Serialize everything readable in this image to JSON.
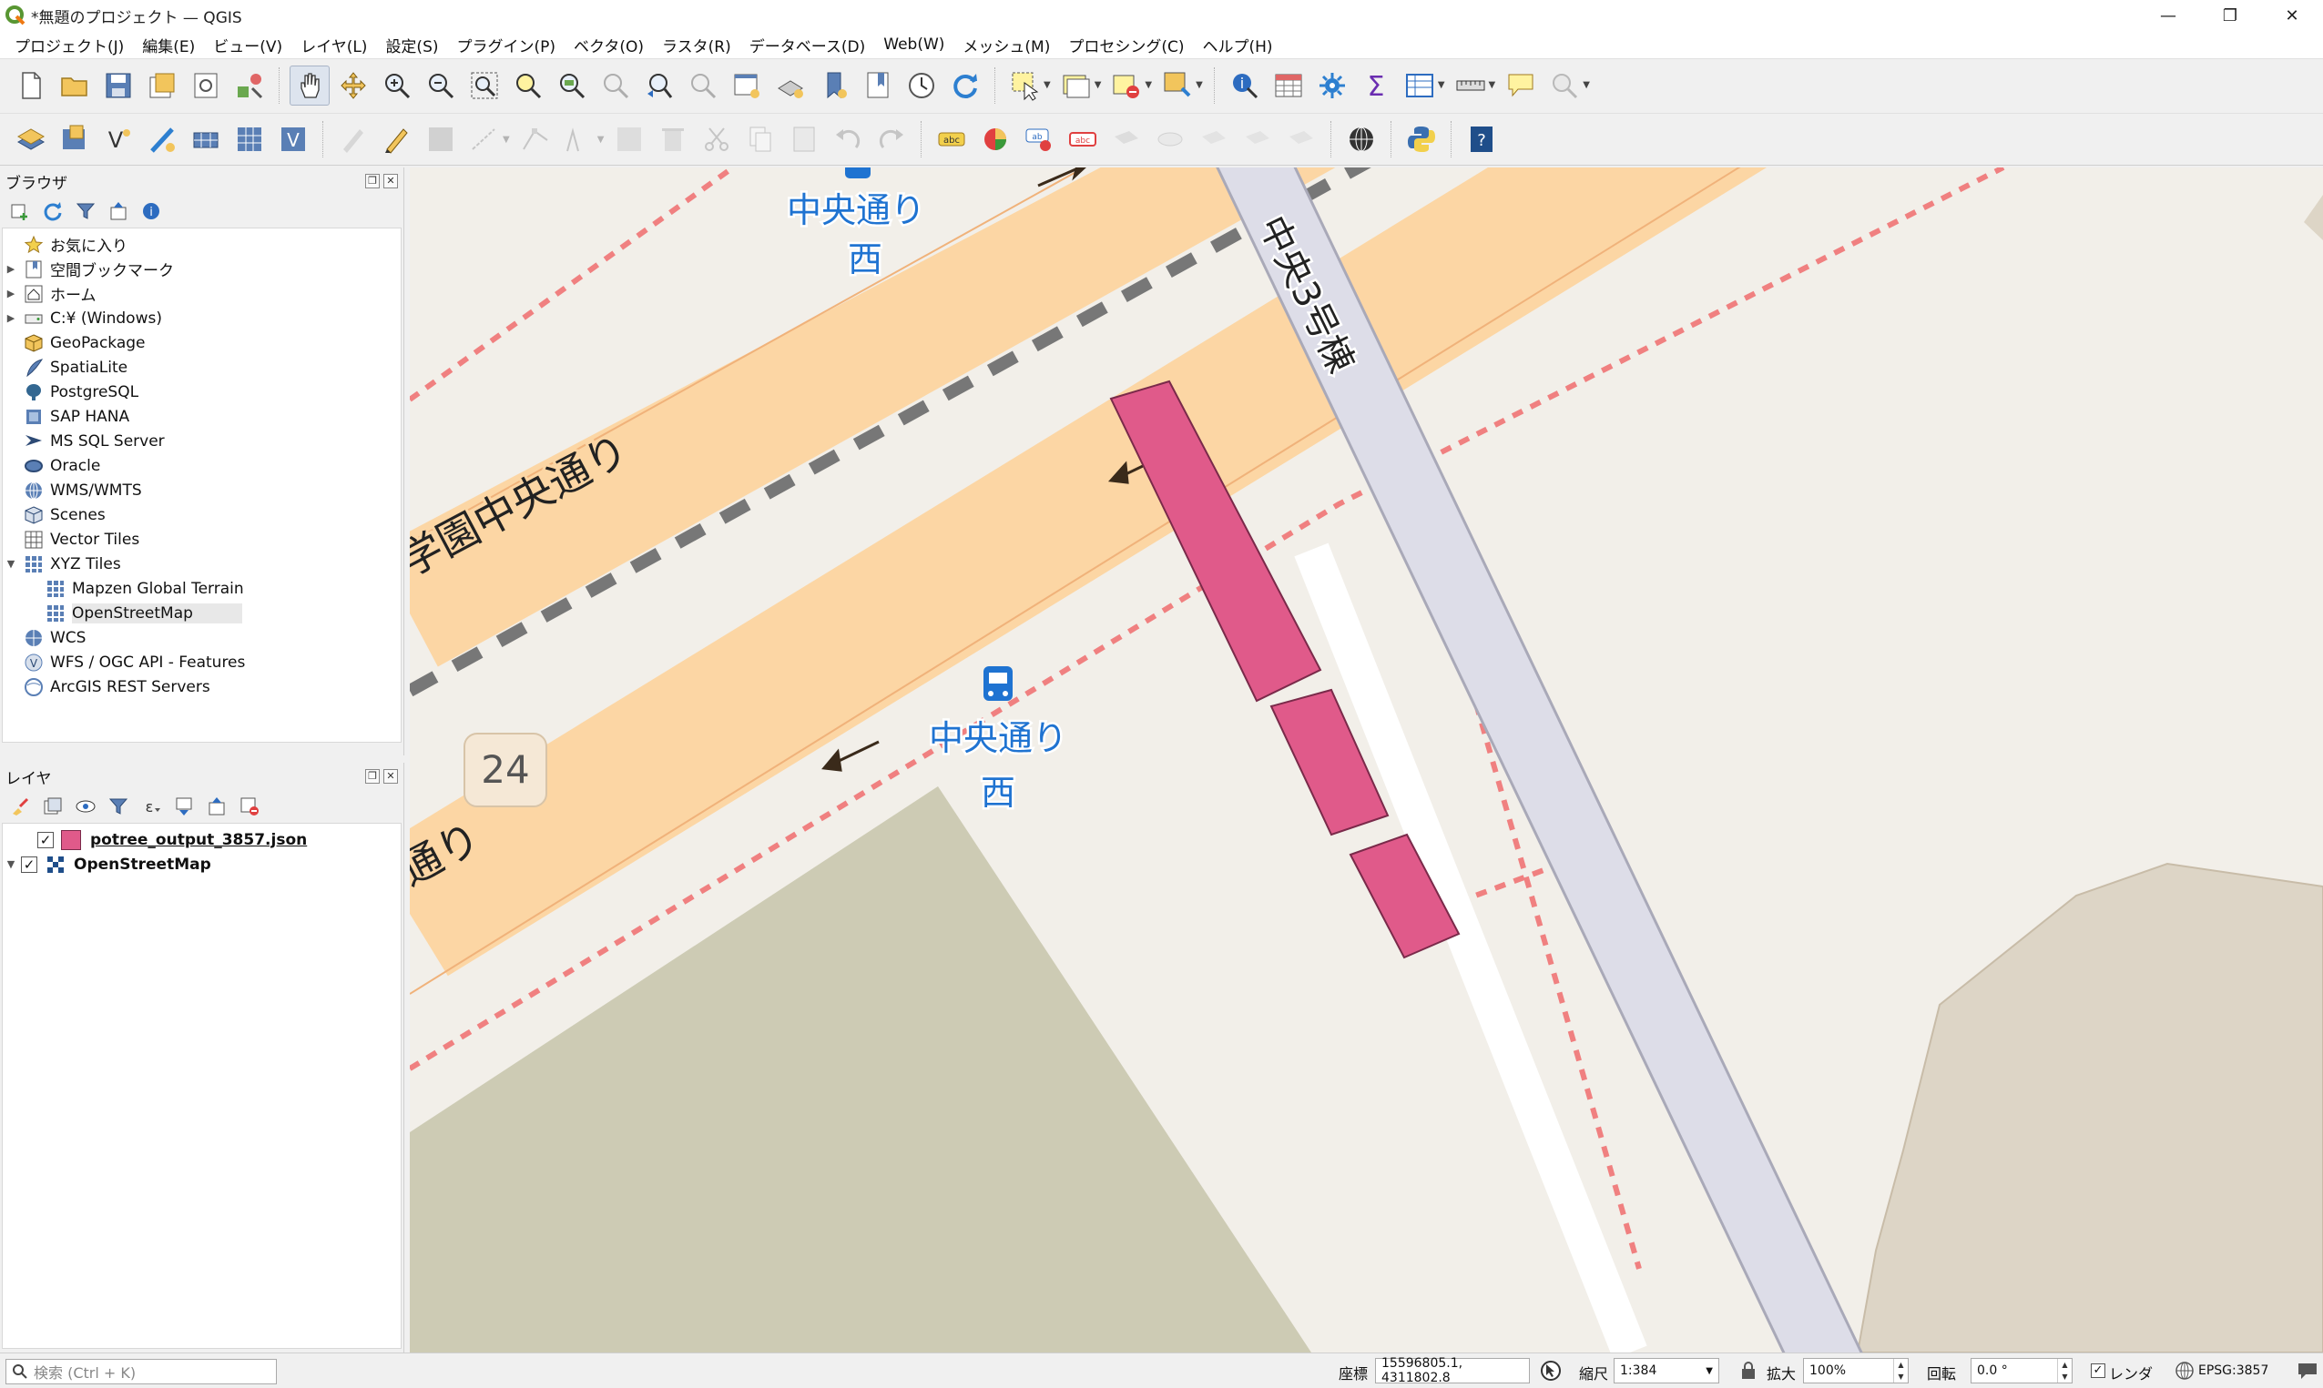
{
  "window": {
    "title": "*無題のプロジェクト — QGIS",
    "minimize": "—",
    "restore": "❐",
    "close": "✕"
  },
  "menu": [
    "プロジェクト(J)",
    "編集(E)",
    "ビュー(V)",
    "レイヤ(L)",
    "設定(S)",
    "プラグイン(P)",
    "ベクタ(O)",
    "ラスタ(R)",
    "データベース(D)",
    "Web(W)",
    "メッシュ(M)",
    "プロセシング(C)",
    "ヘルプ(H)"
  ],
  "browser": {
    "title": "ブラウザ",
    "items": [
      {
        "label": "お気に入り",
        "icon": "star-icon"
      },
      {
        "label": "空間ブックマーク",
        "icon": "bookmark-icon"
      },
      {
        "label": "ホーム",
        "icon": "home-icon"
      },
      {
        "label": "C:¥ (Windows)",
        "icon": "drive-icon"
      },
      {
        "label": "GeoPackage",
        "icon": "geopackage-icon"
      },
      {
        "label": "SpatiaLite",
        "icon": "spatialite-icon"
      },
      {
        "label": "PostgreSQL",
        "icon": "postgresql-icon"
      },
      {
        "label": "SAP HANA",
        "icon": "sap-hana-icon"
      },
      {
        "label": "MS SQL Server",
        "icon": "mssql-icon"
      },
      {
        "label": "Oracle",
        "icon": "oracle-icon"
      },
      {
        "label": "WMS/WMTS",
        "icon": "wms-icon"
      },
      {
        "label": "Scenes",
        "icon": "scenes-icon"
      },
      {
        "label": "Vector Tiles",
        "icon": "vector-tiles-icon"
      },
      {
        "label": "XYZ Tiles",
        "icon": "xyz-tiles-icon"
      },
      {
        "label": "Mapzen Global Terrain",
        "icon": "xyz-tiles-icon"
      },
      {
        "label": "OpenStreetMap",
        "icon": "xyz-tiles-icon"
      },
      {
        "label": "WCS",
        "icon": "wcs-icon"
      },
      {
        "label": "WFS / OGC API - Features",
        "icon": "wfs-icon"
      },
      {
        "label": "ArcGIS REST Servers",
        "icon": "arcgis-icon"
      }
    ]
  },
  "layers": {
    "title": "レイヤ",
    "items": [
      {
        "label": "potree_output_3857.json",
        "checked": "✓",
        "swatch": "#e05a8a"
      },
      {
        "label": "OpenStreetMap",
        "checked": "✓"
      }
    ]
  },
  "map": {
    "labels": {
      "bus_stop_1_line1": "中央通り",
      "bus_stop_1_line2": "西",
      "bus_stop_2_line1": "中央通り",
      "bus_stop_2_line2": "西",
      "road_main": "学園中央通り",
      "road_main_tail": "通り",
      "road_vertical": "中央3号棟",
      "route_number": "24"
    },
    "colors": {
      "background": "#f2efe9",
      "primary_road": "#fcd6a4",
      "footway": "#dddde8",
      "polygon_fill": "#e05a8a",
      "park": "#cdcbb4",
      "boundary": "#f08080",
      "bus_label": "#1f73d1"
    }
  },
  "status": {
    "search_placeholder": "検索 (Ctrl + K)",
    "coord_label": "座標",
    "coord_value": "15596805.1, 4311802.8",
    "scale_label": "縮尺",
    "scale_value": "1:384",
    "magnifier_label": "拡大",
    "magnifier_value": "100%",
    "rotation_label": "回転",
    "rotation_value": "0.0 °",
    "render_label": "レンダ",
    "crs": "EPSG:3857"
  }
}
